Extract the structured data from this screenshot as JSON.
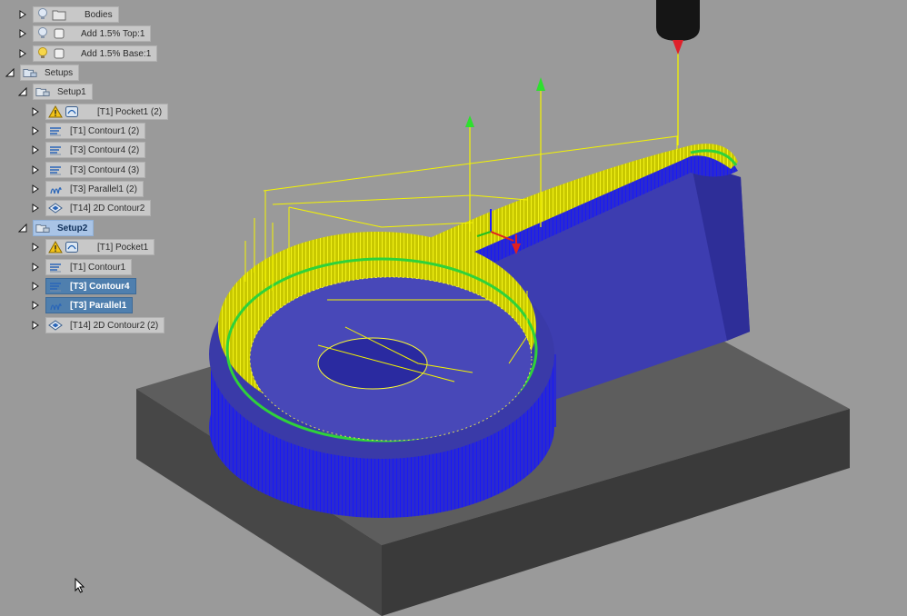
{
  "colors": {
    "background": "#9a9a9a",
    "stock_top": "#5d5d5d",
    "stock_side": "#3e3e3e",
    "part_blue": "#3a3aa8",
    "toolpath_blue": "#1a1af0",
    "toolpath_yellow": "#f4f400",
    "toolpath_green": "#2fd23a",
    "arrow_green": "#2ee02e",
    "tool_tip_red": "#e0202a",
    "selected_row": "#4f7fae",
    "active_setup": "#a9c4e6"
  },
  "browser": {
    "items": [
      {
        "id": "bodies",
        "label": "Bodies",
        "icon": "lightbulb-icon",
        "icon2": "folder-icon",
        "expander": "closed",
        "state": "normal"
      },
      {
        "id": "add-top",
        "label": "Add 1.5% Top:1",
        "icon": "lightbulb-icon",
        "icon2": "body-icon",
        "expander": "closed",
        "state": "normal"
      },
      {
        "id": "add-base",
        "label": "Add 1.5% Base:1",
        "icon": "lightbulb-on-icon",
        "icon2": "body-icon",
        "expander": "closed",
        "state": "normal"
      },
      {
        "id": "setups",
        "label": "Setups",
        "icon": "setups-folder-icon",
        "expander": "open",
        "state": "normal"
      },
      {
        "id": "setup1",
        "label": "Setup1",
        "icon": "setup-icon",
        "expander": "open",
        "state": "normal"
      },
      {
        "id": "s1-pocket1",
        "label": "[T1] Pocket1 (2)",
        "icon": "warning-icon",
        "icon2": "pocket-op-icon",
        "expander": "closed",
        "state": "normal"
      },
      {
        "id": "s1-contour1",
        "label": "[T1] Contour1 (2)",
        "icon": "contour-op-icon",
        "expander": "closed",
        "state": "normal"
      },
      {
        "id": "s1-contour4a",
        "label": "[T3] Contour4 (2)",
        "icon": "contour-op-icon",
        "expander": "closed",
        "state": "normal"
      },
      {
        "id": "s1-contour4b",
        "label": "[T3] Contour4 (3)",
        "icon": "contour-op-icon",
        "expander": "closed",
        "state": "normal"
      },
      {
        "id": "s1-parallel1",
        "label": "[T3] Parallel1 (2)",
        "icon": "parallel-op-icon",
        "expander": "closed",
        "state": "normal"
      },
      {
        "id": "s1-2dcontour2",
        "label": "[T14] 2D Contour2",
        "icon": "2d-contour-op-icon",
        "expander": "closed",
        "state": "normal"
      },
      {
        "id": "setup2",
        "label": "Setup2",
        "icon": "setup-icon",
        "expander": "open",
        "state": "active"
      },
      {
        "id": "s2-pocket1",
        "label": "[T1] Pocket1",
        "icon": "warning-icon",
        "icon2": "pocket-op-icon",
        "expander": "closed",
        "state": "normal"
      },
      {
        "id": "s2-contour1",
        "label": "[T1] Contour1",
        "icon": "contour-op-icon",
        "expander": "closed",
        "state": "normal"
      },
      {
        "id": "s2-contour4",
        "label": "[T3] Contour4",
        "icon": "contour-op-icon",
        "expander": "closed",
        "state": "selected"
      },
      {
        "id": "s2-parallel1",
        "label": "[T3] Parallel1",
        "icon": "parallel-op-icon",
        "expander": "closed",
        "state": "selected"
      },
      {
        "id": "s2-2dcontour2",
        "label": "[T14] 2D Contour2 (2)",
        "icon": "2d-contour-op-icon",
        "expander": "closed",
        "state": "normal"
      }
    ]
  }
}
